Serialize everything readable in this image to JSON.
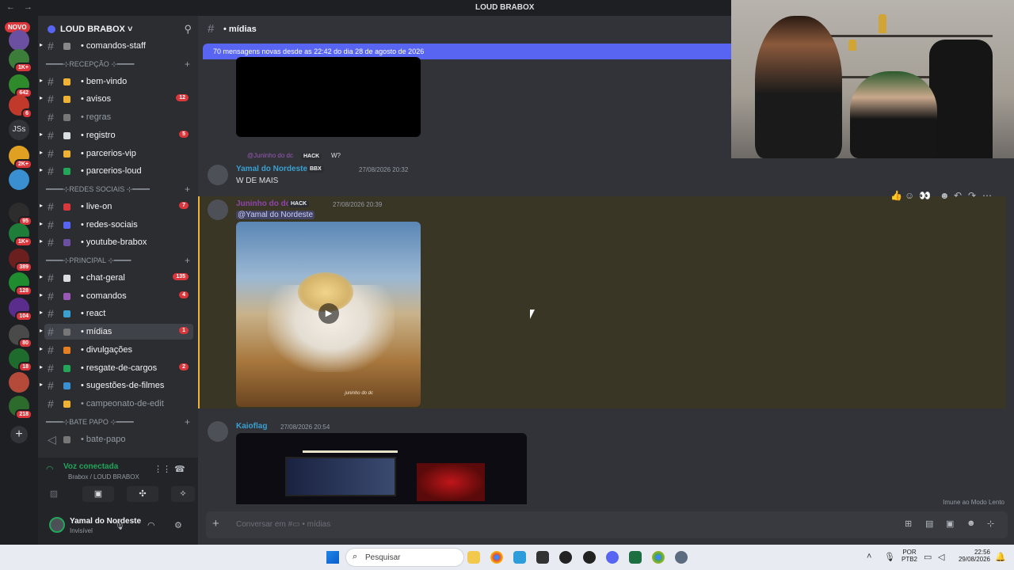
{
  "titlebar": {
    "nav": "← →",
    "title": "LOUD BRABOX"
  },
  "rail": {
    "novo_label": "NOVO",
    "jss_label": "JSs",
    "add_label": "+",
    "servers": [
      {
        "badge": "",
        "color": "#6b4fa0"
      },
      {
        "badge": "1K+",
        "color": "#3c7d3a"
      },
      {
        "badge": "642",
        "color": "#2f8a2b"
      },
      {
        "badge": "6",
        "color": "#c0392b"
      },
      {
        "badge": "2K+",
        "color": "#e0a021"
      },
      {
        "badge": "",
        "color": "#3a8fd1"
      },
      {
        "badge": "95",
        "color": "#2d2d2d"
      },
      {
        "badge": "1K+",
        "color": "#1f7d3a"
      },
      {
        "badge": "389",
        "color": "#6b1f1f"
      },
      {
        "badge": "128",
        "color": "#1f8c2f"
      },
      {
        "badge": "104",
        "color": "#5a2d8c"
      },
      {
        "badge": "80",
        "color": "#4a4a4a"
      },
      {
        "badge": "18",
        "color": "#1f6b2d"
      },
      {
        "badge": "",
        "color": "#b54a3a"
      },
      {
        "badge": "218",
        "color": "#2d6b2d"
      }
    ]
  },
  "sidebar": {
    "server_name": "LOUD BRABOX ˅",
    "channels": [
      {
        "name": "comandos-staff",
        "badge": "",
        "muted": false,
        "emo": "#888"
      },
      {
        "cat": "━━━━⊹RECEPÇÃO ⊹━━━━"
      },
      {
        "name": "bem-vindo",
        "badge": "",
        "muted": false,
        "emo": "#f0b232"
      },
      {
        "name": "avisos",
        "badge": "12",
        "muted": false,
        "emo": "#f0b232"
      },
      {
        "name": "regras",
        "badge": "",
        "muted": true,
        "emo": "#777"
      },
      {
        "name": "registro",
        "badge": "5",
        "muted": false,
        "emo": "#dbdee1"
      },
      {
        "name": "parcerios-vip",
        "badge": "",
        "muted": false,
        "emo": "#f0b232"
      },
      {
        "name": "parcerios-loud",
        "badge": "",
        "muted": false,
        "emo": "#23a55a"
      },
      {
        "cat": "━━━━⊹REDES SOCIAIS ⊹━━━━"
      },
      {
        "name": "live-on",
        "badge": "7",
        "muted": false,
        "emo": "#da373c"
      },
      {
        "name": "redes-sociais",
        "badge": "",
        "muted": false,
        "emo": "#5865f2"
      },
      {
        "name": "youtube-brabox",
        "badge": "",
        "muted": false,
        "emo": "#6b4fa0"
      },
      {
        "cat": "━━━━⊹PRINCIPAL ⊹━━━━"
      },
      {
        "name": "chat-geral",
        "badge": "135",
        "muted": false,
        "emo": "#dbdee1"
      },
      {
        "name": "comandos",
        "badge": "4",
        "muted": false,
        "emo": "#9b59b6"
      },
      {
        "name": "react",
        "badge": "",
        "muted": false,
        "emo": "#3aa0d1"
      },
      {
        "name": "mídias",
        "badge": "1",
        "muted": false,
        "emo": "#777",
        "active": true
      },
      {
        "name": "divulgações",
        "badge": "",
        "muted": false,
        "emo": "#e67e22"
      },
      {
        "name": "resgate-de-cargos",
        "badge": "2",
        "muted": false,
        "emo": "#23a55a"
      },
      {
        "name": "sugestões-de-filmes",
        "badge": "",
        "muted": false,
        "emo": "#3a8fd1"
      },
      {
        "name": "campeonato-de-edit",
        "badge": "",
        "muted": true,
        "emo": "#f0b232"
      },
      {
        "cat": "━━━━⊹BATE PAPO ⊹━━━━"
      },
      {
        "name": "bate-papo",
        "badge": "",
        "muted": true,
        "emo": "#777",
        "voice": true
      }
    ]
  },
  "voice": {
    "state": "Voz conectada",
    "where": "Brabox / LOUD BRABOX"
  },
  "user": {
    "name": "Yamal do Nordeste",
    "status": "Invisível"
  },
  "channel_header": {
    "name": "• mídias"
  },
  "new_messages_bar": "70 mensagens novas desde as 22:42 do dia 28 de agosto de 2026",
  "messages": {
    "reply_ref_author": "@Juninho do dc",
    "reply_ref_tag": "HACK",
    "reply_ref_text": "W?",
    "m1_author": "Yamal do Nordeste",
    "m1_tag": "BBX",
    "m1_ts": "27/08/2026 20:32",
    "m1_text": "W DE MAIS",
    "m2_author": "Juninho do dc",
    "m2_tag": "HACK",
    "m2_ts": "27/08/2026 20:39",
    "m2_mention": "@Yamal do Nordeste",
    "m2_watermark": "juninho do dc",
    "m3_author": "Kaioflag",
    "m3_ts": "27/08/2026 20:54"
  },
  "slowmode": "Imune ao Modo Lento",
  "composer": {
    "placeholder": "Conversar em #▭ • mídias"
  },
  "taskbar": {
    "search": "Pesquisar",
    "lang_top": "POR",
    "lang_bottom": "PTB2",
    "time": "22:56",
    "date": "29/08/2026"
  },
  "colors": {
    "accent": "#5865f2",
    "mention_badge": "#da373c",
    "highlight_border": "#f0b232",
    "m1_author": "#3aa0d1",
    "m2_author": "#8e44ad",
    "m3_author": "#3aa0d1"
  }
}
